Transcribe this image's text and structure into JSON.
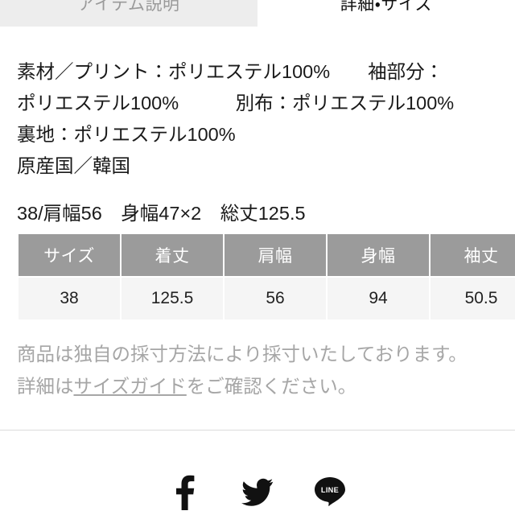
{
  "tabs": [
    {
      "label": "アイテム説明",
      "active": false
    },
    {
      "label": "詳細・サイズ",
      "active": true
    }
  ],
  "description": {
    "lines": [
      "素材／プリント：ポリエステル100%　　袖部分：",
      "ポリエステル100%　　　別布：ポリエステル100%",
      "裏地：ポリエステル100%",
      "原産国／韓国"
    ]
  },
  "summary": {
    "text": "38/肩幅56　身幅47×2　総丈125.5"
  },
  "size_table": {
    "headers": [
      "サイズ",
      "着丈",
      "肩幅",
      "身幅",
      "袖丈"
    ],
    "rows": [
      [
        "38",
        "125.5",
        "56",
        "94",
        "50.5"
      ]
    ]
  },
  "disclaimer": {
    "line1": "商品は独自の採寸方法により採寸いたしております。",
    "line2_prefix": "詳細は",
    "link_text": "サイズガイド",
    "line2_suffix": "をご確認ください。"
  },
  "social": {
    "items": [
      {
        "name": "facebook",
        "label": "f"
      },
      {
        "name": "twitter",
        "label": ""
      },
      {
        "name": "line",
        "label": "LINE"
      }
    ]
  },
  "colors": {
    "tab_inactive_bg": "#ededed",
    "tab_inactive_text": "#9a9a9a",
    "tab_active_text": "#111111",
    "table_header_bg": "#9b9b9b",
    "table_header_text": "#ffffff",
    "table_cell_bg": "#f5f5f5",
    "table_cell_text": "#222222",
    "disclaimer_text": "#a6a6a6",
    "divider": "#dcdcdc",
    "icon": "#111111"
  }
}
